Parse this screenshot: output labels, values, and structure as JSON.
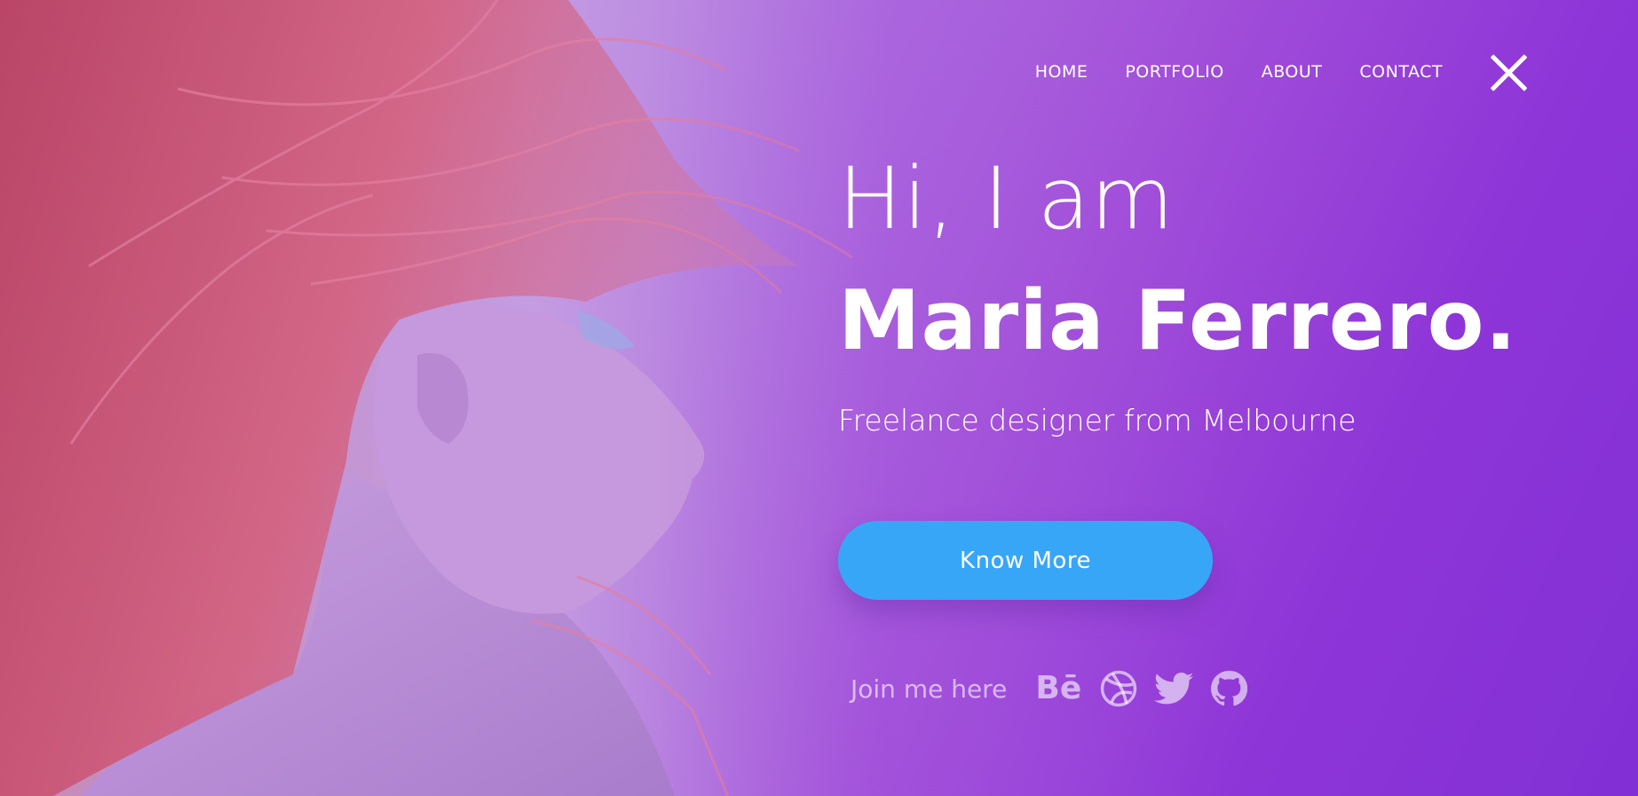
{
  "nav": {
    "items": [
      {
        "label": "HOME"
      },
      {
        "label": "PORTFOLIO"
      },
      {
        "label": "ABOUT"
      },
      {
        "label": "CONTACT"
      }
    ],
    "close_icon": "close-icon"
  },
  "hero": {
    "greeting": "Hi, I am",
    "name": "Maria Ferrero.",
    "subtitle": "Freelance designer from Melbourne",
    "cta_label": "Know More"
  },
  "social": {
    "label": "Join me here",
    "behance_text": "Bē",
    "icons": [
      "behance-icon",
      "dribbble-icon",
      "twitter-icon",
      "github-icon"
    ]
  },
  "colors": {
    "gradient_start": "#c7a4e8",
    "gradient_end": "#8130d6",
    "button": "#38a6f7",
    "text": "#ffffff",
    "hair": "#d4607e"
  }
}
